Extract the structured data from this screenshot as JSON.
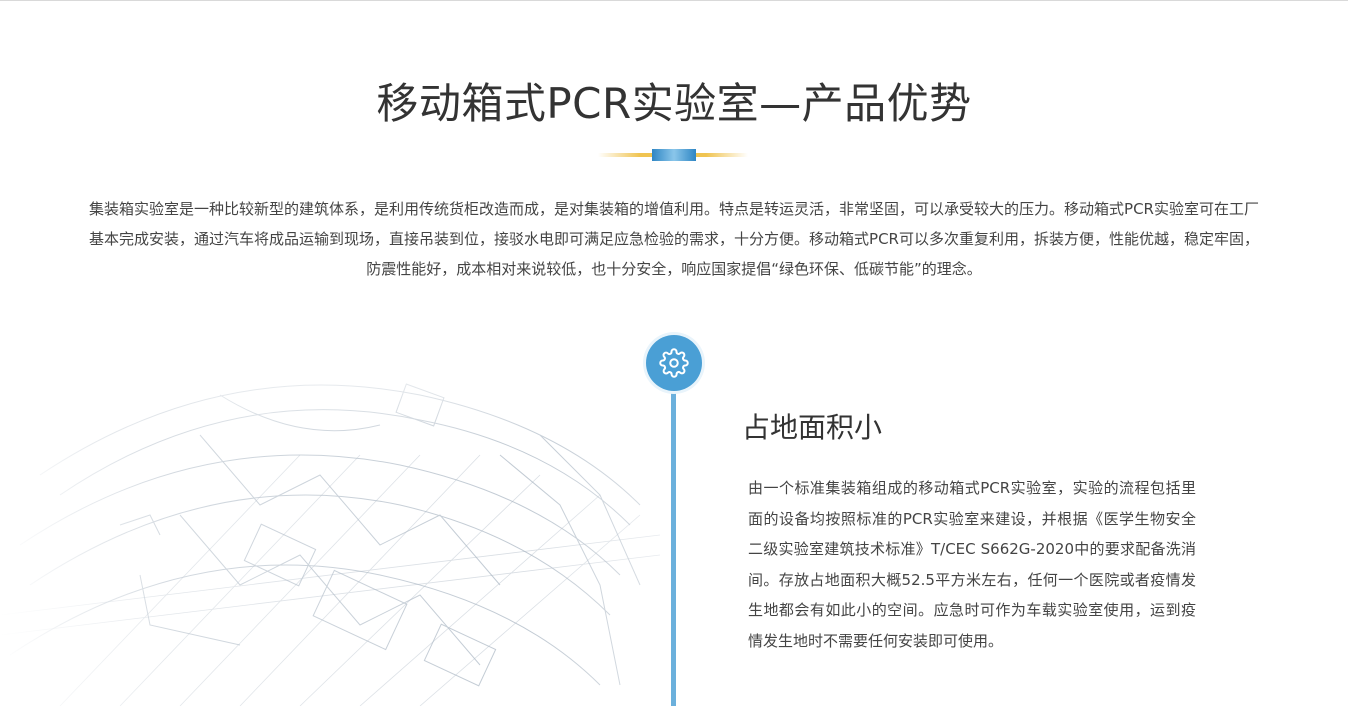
{
  "section": {
    "title": "移动箱式PCR实验室—产品优势",
    "intro": "集装箱实验室是一种比较新型的建筑体系，是利用传统货柜改造而成，是对集装箱的增值利用。特点是转运灵活，非常坚固，可以承受较大的压力。移动箱式PCR实验室可在工厂基本完成安装，通过汽车将成品运输到现场，直接吊装到位，接驳水电即可满足应急检验的需求，十分方便。移动箱式PCR可以多次重复利用，拆装方便，性能优越，稳定牢固，防震性能好，成本相对来说较低，也十分安全，响应国家提倡“绿色环保、低碳节能”的理念。"
  },
  "feature": {
    "icon": "gear-icon",
    "title": "占地面积小",
    "description": "由一个标准集装箱组成的移动箱式PCR实验室，实验的流程包括里面的设备均按照标准的PCR实验室来建设，并根据《医学生物安全二级实验室建筑技术标准》T/CEC S662G-2020中的要求配备洗消间。存放占地面积大概52.5平方米左右，任何一个医院或者疫情发生地都会有如此小的空间。应急时可作为车载实验室使用，运到疫情发生地时不需要任何安装即可使用。"
  },
  "colors": {
    "accent_blue": "#4a9fd5",
    "timeline_blue": "#6bb0dc",
    "divider_gold": "#f0c451",
    "text": "#333333"
  }
}
